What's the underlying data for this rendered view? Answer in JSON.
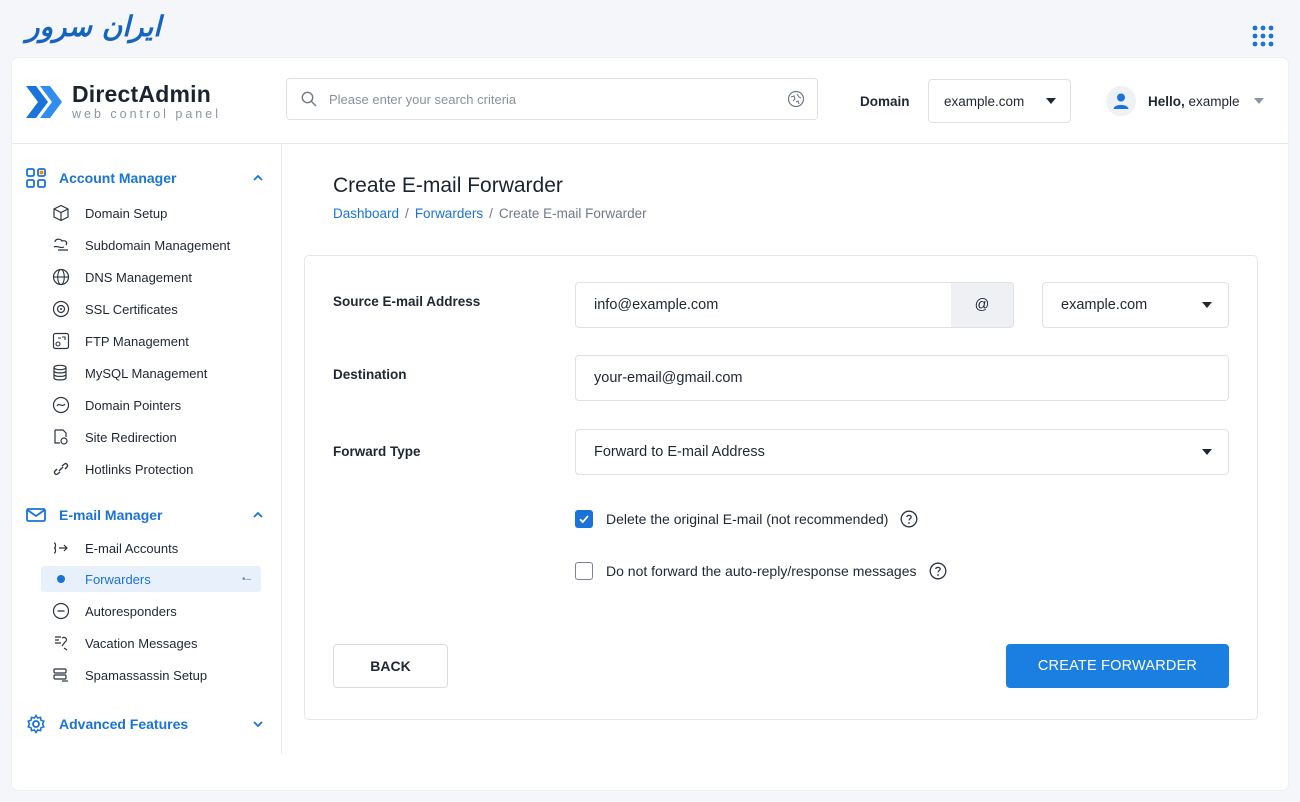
{
  "brand": {
    "logo_text": "ایران سرور"
  },
  "header": {
    "app_name": "DirectAdmin",
    "app_subtitle": "web control panel",
    "search_placeholder": "Please enter your search criteria",
    "domain_label": "Domain",
    "domain_value": "example.com",
    "greeting": "Hello,",
    "username": "example"
  },
  "sidebar": {
    "sections": [
      {
        "label": "Account Manager",
        "expanded": true,
        "items": [
          "Domain Setup",
          "Subdomain Management",
          "DNS Management",
          "SSL Certificates",
          "FTP Management",
          "MySQL Management",
          "Domain Pointers",
          "Site Redirection",
          "Hotlinks Protection"
        ]
      },
      {
        "label": "E-mail Manager",
        "expanded": true,
        "items": [
          "E-mail Accounts",
          "Forwarders",
          "Autoresponders",
          "Vacation Messages",
          "Spamassassin Setup"
        ]
      },
      {
        "label": "Advanced Features",
        "expanded": false,
        "items": []
      }
    ],
    "active_item": "Forwarders"
  },
  "page": {
    "title": "Create E-mail Forwarder",
    "breadcrumb": [
      "Dashboard",
      "Forwarders",
      "Create E-mail Forwarder"
    ],
    "separator": "/"
  },
  "form": {
    "source_label": "Source E-mail Address",
    "source_value": "info@example.com",
    "at_symbol": "@",
    "source_domain": "example.com",
    "destination_label": "Destination",
    "destination_value": "your-email@gmail.com",
    "forward_type_label": "Forward Type",
    "forward_type_value": "Forward to E-mail Address",
    "delete_original_label": "Delete the original E-mail (not recommended)",
    "delete_original_checked": true,
    "no_autoreply_label": "Do not forward the auto-reply/response messages",
    "no_autoreply_checked": false,
    "back_label": "BACK",
    "create_label": "CREATE FORWARDER"
  },
  "colors": {
    "accent": "#1a73d9",
    "button": "#1a7fe0",
    "logo_blue": "#1565c0"
  }
}
